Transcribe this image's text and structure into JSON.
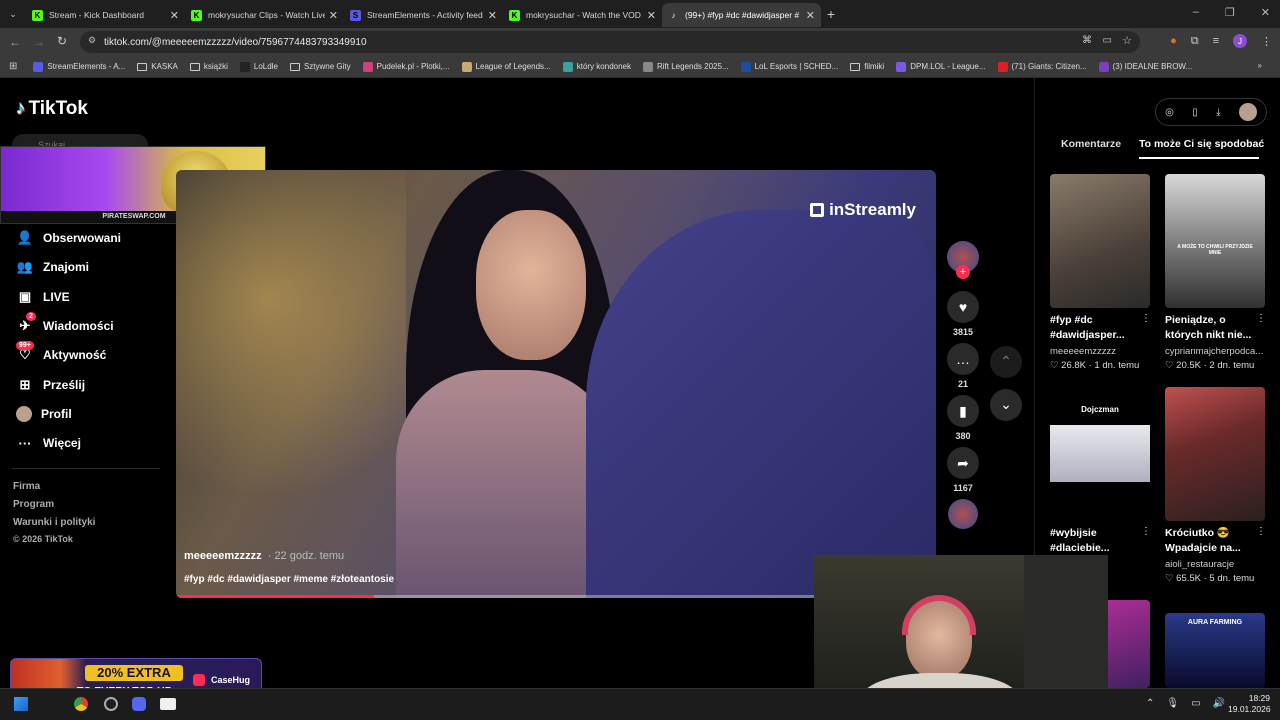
{
  "browser": {
    "tabs": [
      {
        "title": "Stream - Kick Dashboard",
        "fav_color": "#53fc18",
        "fav_glyph": "K"
      },
      {
        "title": "mokrysuchar Clips - Watch Live",
        "fav_color": "#53fc18",
        "fav_glyph": "K"
      },
      {
        "title": "StreamElements - Activity feed",
        "fav_color": "#5a5ae6",
        "fav_glyph": "S"
      },
      {
        "title": "mokrysuchar - Watch the VOD",
        "fav_color": "#53fc18",
        "fav_glyph": "K"
      },
      {
        "title": "(99+) #fyp #dc #dawidjasper #",
        "fav_color": "#ffffff",
        "fav_glyph": "♪"
      }
    ],
    "url": "tiktok.com/@meeeeemzzzzz/video/7596774483793349910",
    "bookmarks": [
      {
        "label": "StreamElements - A...",
        "color": "#5a5ae6"
      },
      {
        "label": "KASKA",
        "color": "folder"
      },
      {
        "label": "książki",
        "color": "folder"
      },
      {
        "label": "LoLdle",
        "color": "#222"
      },
      {
        "label": "Sztywne Gity",
        "color": "folder"
      },
      {
        "label": "Pudelek.pl - Plotki,...",
        "color": "#d04080"
      },
      {
        "label": "League of Legends...",
        "color": "#c8aa6e"
      },
      {
        "label": "który kondonek",
        "color": "#3aa0a0"
      },
      {
        "label": "Rift Legends 2025...",
        "color": "#888"
      },
      {
        "label": "LoL Esports | SCHED...",
        "color": "#1a4fa0"
      },
      {
        "label": "filmiki",
        "color": "folder"
      },
      {
        "label": "DPM.LOL - League...",
        "color": "#7a5ae0"
      },
      {
        "label": "(71) Giants: Citizen...",
        "color": "#e02020"
      },
      {
        "label": "(3) IDEALNE BROW...",
        "color": "#7a40c0"
      }
    ]
  },
  "tiktok": {
    "logo": "TikTok",
    "search_placeholder": "Szukaj",
    "promo_banner_text": "PIRATESWAP.COM",
    "nav": [
      {
        "label": "Obserwowani",
        "icon": "following-icon",
        "glyph": "👤"
      },
      {
        "label": "Znajomi",
        "icon": "friends-icon",
        "glyph": "👥"
      },
      {
        "label": "LIVE",
        "icon": "live-icon",
        "glyph": "▣"
      },
      {
        "label": "Wiadomości",
        "icon": "messages-icon",
        "glyph": "✈",
        "badge": "2"
      },
      {
        "label": "Aktywność",
        "icon": "activity-icon",
        "glyph": "♡",
        "badge": "99+"
      },
      {
        "label": "Prześlij",
        "icon": "upload-icon",
        "glyph": "⊞"
      },
      {
        "label": "Profil",
        "icon": "profile-icon",
        "glyph": "●"
      },
      {
        "label": "Więcej",
        "icon": "more-icon",
        "glyph": "···"
      }
    ],
    "footer": [
      "Firma",
      "Program",
      "Warunki i polityki",
      "© 2026 TikTok"
    ],
    "video": {
      "watermark": "inStreamly",
      "author": "meeeeemzzzzz",
      "time_ago": "· 22 godz. temu",
      "hashtags": "#fyp #dc #dawidjasper #meme #złoteantosie",
      "progress": 0.26
    },
    "actions": {
      "likes": "3815",
      "comments": "21",
      "saves": "380",
      "shares": "1167"
    },
    "right_tabs": [
      "Komentarze",
      "To może Ci się spodobać"
    ],
    "cards": [
      {
        "title": "#fyp #dc #dawidjasper...",
        "author": "meeeeemzzzzz",
        "stats": "♡ 26.8K · 1 dn. temu"
      },
      {
        "title": "Pieniądze, o których nikt nie...",
        "author": "cyprianmajcherpodca...",
        "stats": "♡ 20.5K · 2 dn. temu",
        "overlay": "A MOŻE TO CHWILI PRZYJDZIE MNIE"
      },
      {
        "title": "#wybijsie #dlaciebie...",
        "author": "6",
        "stats": "tem",
        "overlay": "Dojczman"
      },
      {
        "title": "Króciutko 😎 Wpadajcie na...",
        "author": "aioli_restauracje",
        "stats": "♡ 65.5K · 5 dn. temu"
      },
      {
        "title": "",
        "author": "",
        "stats": "",
        "overlay": "AURA FARMING"
      }
    ]
  },
  "overlay": {
    "promo_line1": "20% EXTRA",
    "promo_line2": "TO EVERY TOP-UP",
    "promo_brand": "CaseHug"
  },
  "taskbar": {
    "time": "18:29",
    "date": "19.01.2026"
  }
}
